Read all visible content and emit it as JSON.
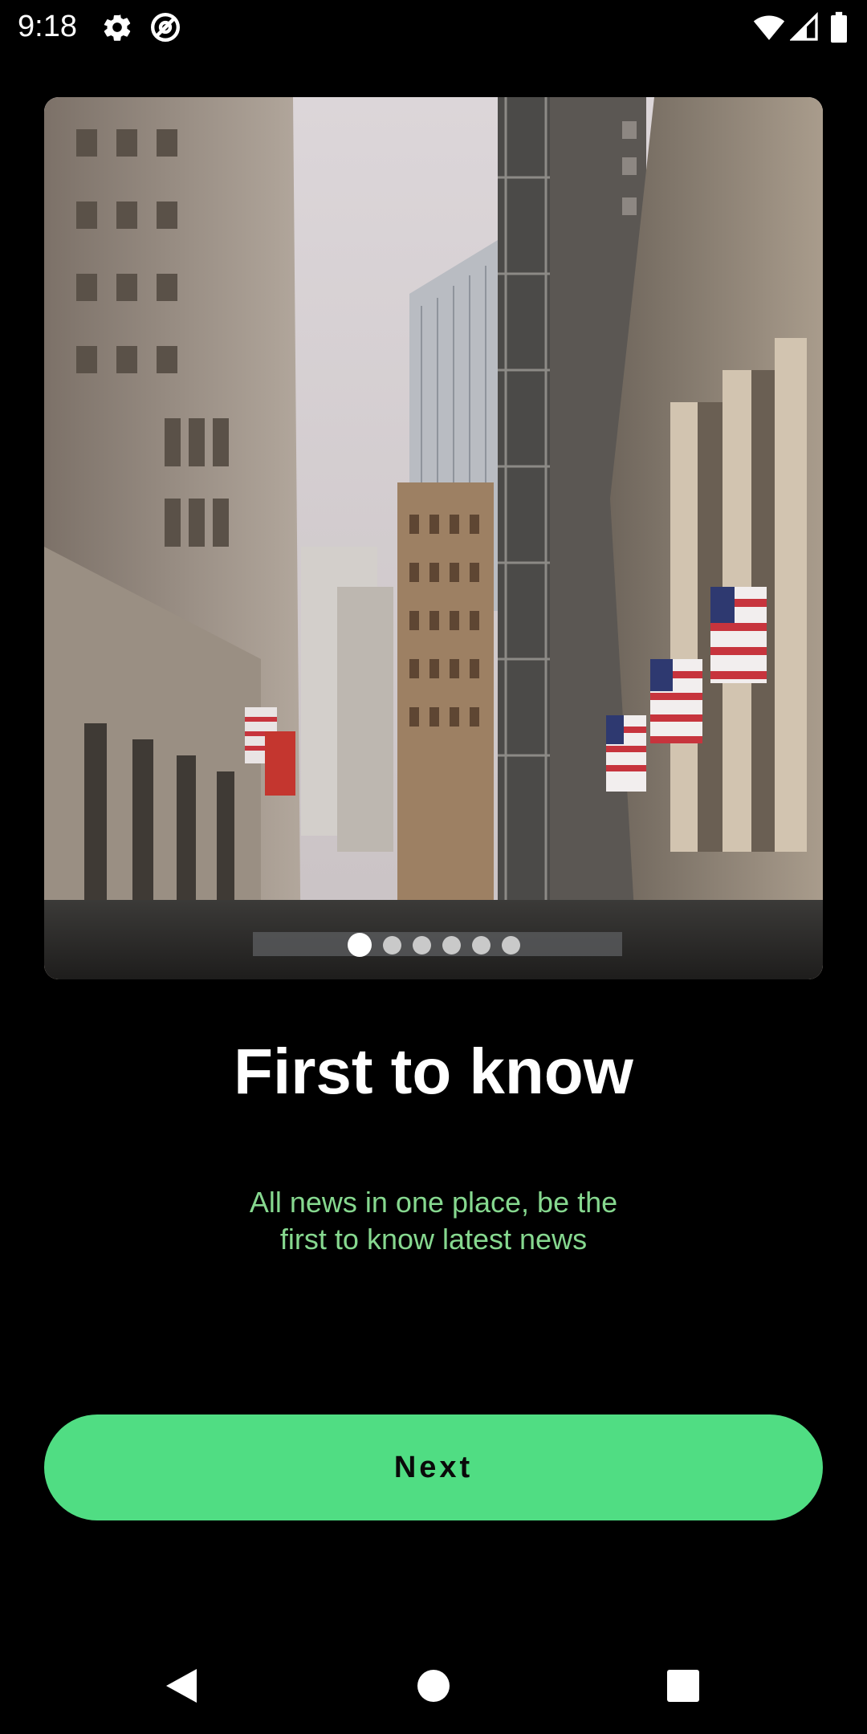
{
  "status_bar": {
    "time": "9:18",
    "left_icons": [
      "gear-icon",
      "at-sign-icon"
    ],
    "right_icons": [
      "wifi-icon",
      "signal-icon",
      "battery-icon"
    ]
  },
  "onboarding": {
    "slide_count": 6,
    "active_slide": 1,
    "title": "First to know",
    "subtitle_line1": "All news in one place, be the",
    "subtitle_line2": "first to know latest news",
    "next_label": "Next"
  },
  "colors": {
    "background": "#000000",
    "accent": "#50dd83",
    "subtitle": "#86d88f",
    "title": "#ffffff"
  },
  "nav_bar": {
    "buttons": [
      "back-icon",
      "home-icon",
      "recents-icon"
    ]
  }
}
